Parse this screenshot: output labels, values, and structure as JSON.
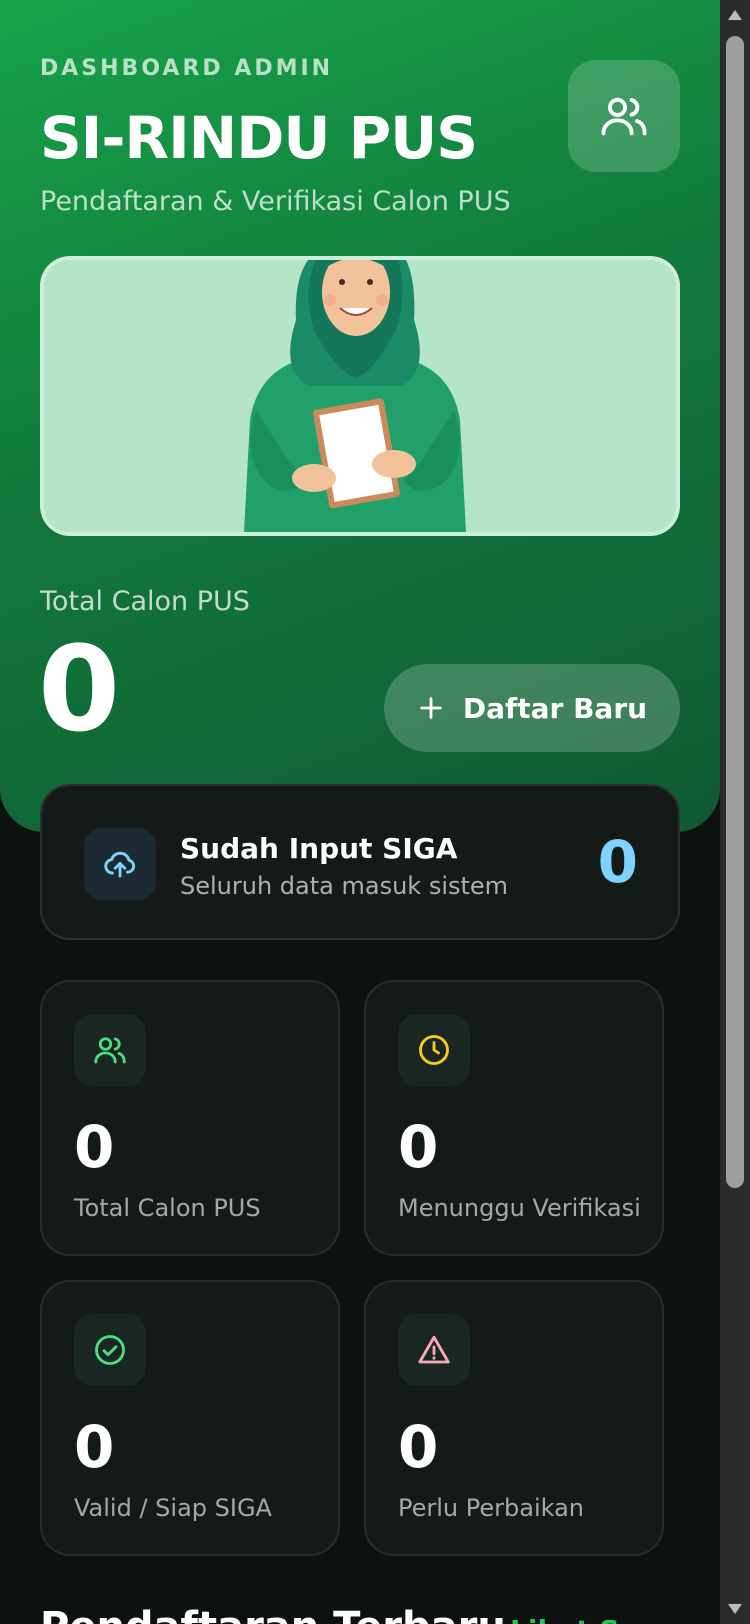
{
  "header": {
    "eyebrow": "DASHBOARD ADMIN",
    "title": "SI-RINDU PUS",
    "subtitle": "Pendaftaran & Verifikasi Calon PUS",
    "icon": "users-icon"
  },
  "hero_summary": {
    "label": "Total Calon PUS",
    "value": "0",
    "register_button_label": "Daftar Baru",
    "register_icon": "plus-icon"
  },
  "siga_card": {
    "title": "Sudah Input SIGA",
    "subtitle": "Seluruh data masuk sistem",
    "count": "0",
    "icon": "cloud-upload-icon"
  },
  "stats": [
    {
      "value": "0",
      "label": "Total Calon PUS",
      "icon": "users-icon",
      "color": "#4ade80"
    },
    {
      "value": "0",
      "label": "Menunggu Verifikasi",
      "icon": "clock-icon",
      "color": "#facc15"
    },
    {
      "value": "0",
      "label": "Valid / Siap SIGA",
      "icon": "check-circle-icon",
      "color": "#4ade80"
    },
    {
      "value": "0",
      "label": "Perlu Perbaikan",
      "icon": "warning-icon",
      "color": "#f9a8b8"
    }
  ],
  "recent_section": {
    "title": "Pendaftaran Terbaru",
    "link": "Lihat Semua"
  },
  "colors": {
    "hero_start": "#17a34a",
    "hero_end": "#0f5a31",
    "background": "#0d1110",
    "accent_blue": "#7dd3fc"
  }
}
